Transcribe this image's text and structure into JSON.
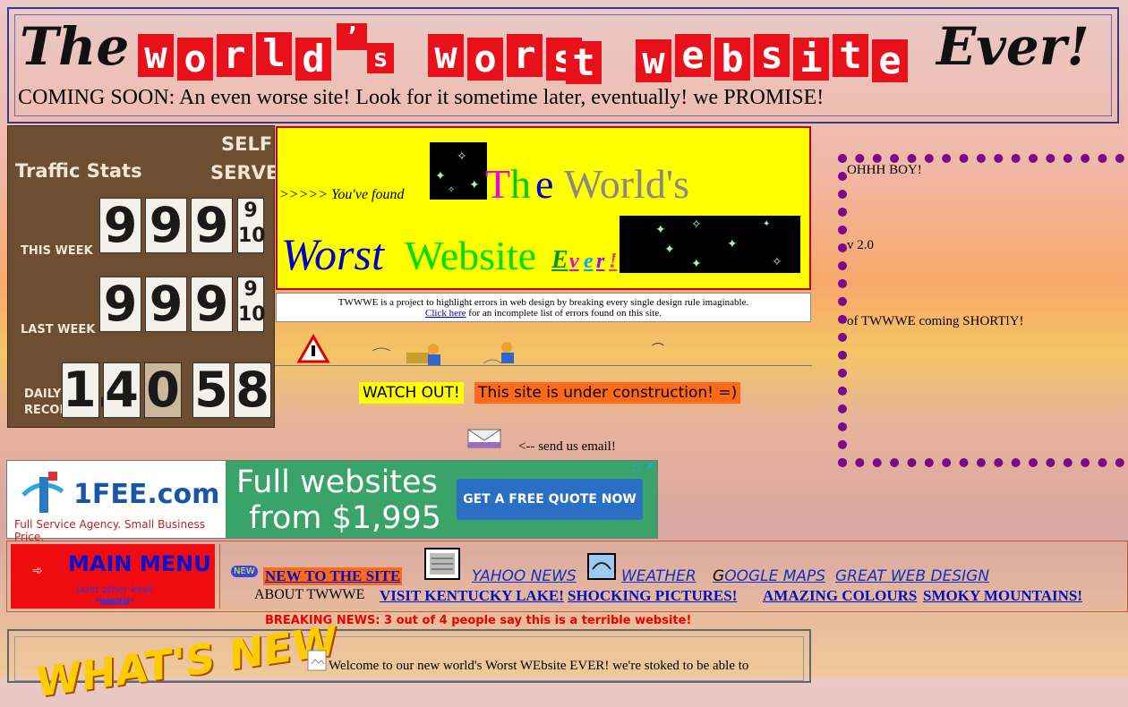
{
  "header": {
    "title_the": "The",
    "title_word1": [
      "w",
      "o",
      "r",
      "l",
      "d"
    ],
    "title_apos": "’",
    "title_s": "s",
    "title_word2": [
      "w",
      "o",
      "r",
      "s",
      "t"
    ],
    "title_word3": [
      "w",
      "e",
      "b",
      "s",
      "i",
      "t",
      "e"
    ],
    "title_ever": "Ever!",
    "coming_soon": "COMING SOON: An even worse site! Look for it sometime later, eventually!  we PROMISE!"
  },
  "stats": {
    "title": "Traffic Stats",
    "self": "SELF",
    "serve": "SERVE",
    "this_week_label": "THIS WEEK",
    "last_week_label": "LAST WEEK",
    "daily_label": "DAILY",
    "record_label": "RECOR",
    "this_week_digits": [
      "9",
      "9",
      "9"
    ],
    "last_week_digits": [
      "9",
      "9",
      "9"
    ],
    "frac_top": "9",
    "frac_bottom": "10",
    "daily_digits": [
      "1.",
      "4",
      "0",
      "5",
      "8"
    ]
  },
  "banner": {
    "found": ">>>>> You've found",
    "the_t": "T",
    "the_h": "h",
    "the_e": "e",
    "worlds": "World's",
    "worst": "Worst",
    "website": "Website",
    "ever": [
      "E",
      "v",
      "e",
      "r",
      "!"
    ]
  },
  "description": {
    "text": "TWWWE is a project to highlight errors in web design by breaking every single design rule imaginable.",
    "link": "Click here",
    "link_rest": " for an incomplete list of errors found on this site."
  },
  "construction": {
    "watch_out": "WATCH OUT!",
    "under": "This site is under construction! =)",
    "email": "<-- send us email!"
  },
  "side": {
    "line1": "OHHH BOY!",
    "line2": "v 2.0",
    "line3": "of TWWWE coming SHORTlY!"
  },
  "ad": {
    "brand": "1FEE.com",
    "tagline": "Full Service Agency. Small Business Price.",
    "headline1": "Full websites",
    "headline2": "from $1,995",
    "cta": "GET A FREE QUOTE NOW"
  },
  "menu": {
    "title": "MAIN MENU",
    "sub": "(and other kewl links!)",
    "smile": "*smile*",
    "new_badge": "NEW",
    "new_to_site": "NEW TO THE SITE",
    "yahoo": "YAHOO NEWS",
    "weather": "WEATHER",
    "google_g": "G",
    "google_rest": "OOGLE MAPS",
    "great_design": "GREAT WEB DESIGN",
    "about": "ABOUT TWWWE",
    "kentucky": "VISIT KENTUCKY LAKE!",
    "shocking": "SHOCKING PICTURES!",
    "amazing": "AMAZING COLOURS",
    "smoky": "SMOKY MOUNTAINS!",
    "breaking": "BREAKING NEWS:  3 out of 4 people say this is a terrible website!"
  },
  "whatsnew": {
    "graphic": "WHAT'S NEW",
    "welcome": "Welcome to our new world's Worst WEbsite EVER!  we're stoked to be able to"
  },
  "colors": {
    "title_red": "#e8101a",
    "banner_yellow": "#ffff00",
    "dots_purple": "#7a0a8a",
    "menu_red": "#ee0c10",
    "link_blue": "#0010c8"
  }
}
